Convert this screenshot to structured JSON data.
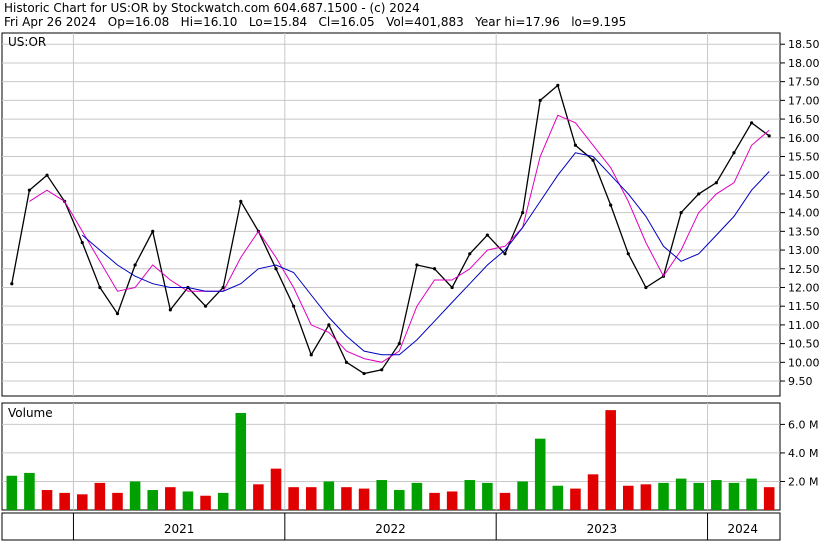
{
  "header": {
    "title_line": "Historic Chart for US:OR by Stockwatch.com 604.687.1500 - (c) 2024",
    "stats_line": "Fri Apr 26 2024   Op=16.08   Hi=16.10   Lo=15.84   Cl=16.05   Vol=401,883   Year hi=17.96   lo=9.195"
  },
  "chart_data": [
    {
      "type": "line",
      "panel": "price",
      "label": "US:OR",
      "ylim": [
        9.1,
        18.8
      ],
      "yticks": [
        9.5,
        10.0,
        10.5,
        11.0,
        11.5,
        12.0,
        12.5,
        13.0,
        13.5,
        14.0,
        14.5,
        15.0,
        15.5,
        16.0,
        16.5,
        17.0,
        17.5,
        18.0,
        18.5
      ],
      "ytick_labels": [
        "9.50",
        "10.00",
        "10.50",
        "11.00",
        "11.50",
        "12.00",
        "12.50",
        "13.00",
        "13.50",
        "14.00",
        "14.50",
        "15.00",
        "15.50",
        "16.00",
        "16.50",
        "17.00",
        "17.50",
        "18.00",
        "18.50"
      ],
      "x_labels": [
        "2021",
        "2022",
        "2023",
        "2024"
      ],
      "grid": true,
      "series": [
        {
          "style": "daily high-low bars",
          "color": "#000000",
          "x": [
            "2020-09",
            "2020-10",
            "2020-11",
            "2020-12",
            "2021-01",
            "2021-02",
            "2021-03",
            "2021-04",
            "2021-05",
            "2021-06",
            "2021-07",
            "2021-08",
            "2021-09",
            "2021-10",
            "2021-11",
            "2021-12",
            "2022-01",
            "2022-02",
            "2022-03",
            "2022-04",
            "2022-05",
            "2022-06",
            "2022-07",
            "2022-08",
            "2022-09",
            "2022-10",
            "2022-11",
            "2022-12",
            "2023-01",
            "2023-02",
            "2023-03",
            "2023-04",
            "2023-05",
            "2023-06",
            "2023-07",
            "2023-08",
            "2023-09",
            "2023-10",
            "2023-11",
            "2023-12",
            "2024-01",
            "2024-02",
            "2024-03",
            "2024-04"
          ],
          "values": [
            12.1,
            14.6,
            15.0,
            14.3,
            13.2,
            12.0,
            11.3,
            12.6,
            13.5,
            11.4,
            12.0,
            11.5,
            12.0,
            14.3,
            13.5,
            12.5,
            11.5,
            10.2,
            11.0,
            10.0,
            9.7,
            9.8,
            10.5,
            12.6,
            12.5,
            12.0,
            12.9,
            13.4,
            12.9,
            14.0,
            17.0,
            17.4,
            15.8,
            15.4,
            14.2,
            12.9,
            12.0,
            12.3,
            14.0,
            14.5,
            14.8,
            15.6,
            16.4,
            16.05
          ]
        },
        {
          "style": "short moving average",
          "color": "#e000c0",
          "x": [
            "2020-09",
            "2020-10",
            "2020-11",
            "2020-12",
            "2021-01",
            "2021-02",
            "2021-03",
            "2021-04",
            "2021-05",
            "2021-06",
            "2021-07",
            "2021-08",
            "2021-09",
            "2021-10",
            "2021-11",
            "2021-12",
            "2022-01",
            "2022-02",
            "2022-03",
            "2022-04",
            "2022-05",
            "2022-06",
            "2022-07",
            "2022-08",
            "2022-09",
            "2022-10",
            "2022-11",
            "2022-12",
            "2023-01",
            "2023-02",
            "2023-03",
            "2023-04",
            "2023-05",
            "2023-06",
            "2023-07",
            "2023-08",
            "2023-09",
            "2023-10",
            "2023-11",
            "2023-12",
            "2024-01",
            "2024-02",
            "2024-03",
            "2024-04"
          ],
          "values": [
            null,
            14.3,
            14.6,
            14.3,
            13.5,
            12.7,
            11.9,
            12.0,
            12.6,
            12.2,
            11.9,
            11.9,
            11.9,
            12.8,
            13.5,
            12.8,
            12.0,
            11.0,
            10.8,
            10.3,
            10.1,
            10.0,
            10.3,
            11.5,
            12.2,
            12.2,
            12.5,
            13.0,
            13.1,
            13.6,
            15.5,
            16.6,
            16.4,
            15.8,
            15.2,
            14.3,
            13.2,
            12.3,
            13.0,
            14.0,
            14.5,
            14.8,
            15.8,
            16.2
          ]
        },
        {
          "style": "long moving average",
          "color": "#0000c0",
          "x": [
            "2020-09",
            "2020-10",
            "2020-11",
            "2020-12",
            "2021-01",
            "2021-02",
            "2021-03",
            "2021-04",
            "2021-05",
            "2021-06",
            "2021-07",
            "2021-08",
            "2021-09",
            "2021-10",
            "2021-11",
            "2021-12",
            "2022-01",
            "2022-02",
            "2022-03",
            "2022-04",
            "2022-05",
            "2022-06",
            "2022-07",
            "2022-08",
            "2022-09",
            "2022-10",
            "2022-11",
            "2022-12",
            "2023-01",
            "2023-02",
            "2023-03",
            "2023-04",
            "2023-05",
            "2023-06",
            "2023-07",
            "2023-08",
            "2023-09",
            "2023-10",
            "2023-11",
            "2023-12",
            "2024-01",
            "2024-02",
            "2024-03",
            "2024-04"
          ],
          "values": [
            null,
            null,
            null,
            null,
            13.4,
            13.0,
            12.6,
            12.3,
            12.1,
            12.0,
            12.0,
            11.9,
            11.9,
            12.1,
            12.5,
            12.6,
            12.4,
            11.8,
            11.2,
            10.7,
            10.3,
            10.2,
            10.2,
            10.6,
            11.1,
            11.6,
            12.1,
            12.6,
            13.0,
            13.6,
            14.3,
            15.0,
            15.6,
            15.5,
            15.0,
            14.5,
            13.9,
            13.1,
            12.7,
            12.9,
            13.4,
            13.9,
            14.6,
            15.1
          ]
        }
      ]
    },
    {
      "type": "bar",
      "panel": "volume",
      "label": "Volume",
      "ylim": [
        0,
        7.5
      ],
      "yticks": [
        2,
        4,
        6
      ],
      "ytick_labels": [
        "2.0 M",
        "4.0 M",
        "6.0 M"
      ],
      "grid": true,
      "colors": {
        "up": "#00a000",
        "down": "#e00000"
      },
      "x": [
        "2020-09",
        "2020-10",
        "2020-11",
        "2020-12",
        "2021-01",
        "2021-02",
        "2021-03",
        "2021-04",
        "2021-05",
        "2021-06",
        "2021-07",
        "2021-08",
        "2021-09",
        "2021-10",
        "2021-11",
        "2021-12",
        "2022-01",
        "2022-02",
        "2022-03",
        "2022-04",
        "2022-05",
        "2022-06",
        "2022-07",
        "2022-08",
        "2022-09",
        "2022-10",
        "2022-11",
        "2022-12",
        "2023-01",
        "2023-02",
        "2023-03",
        "2023-04",
        "2023-05",
        "2023-06",
        "2023-07",
        "2023-08",
        "2023-09",
        "2023-10",
        "2023-11",
        "2023-12",
        "2024-01",
        "2024-02",
        "2024-03",
        "2024-04"
      ],
      "values": [
        2.4,
        2.6,
        1.4,
        1.2,
        1.1,
        1.9,
        1.2,
        2.0,
        1.4,
        1.6,
        1.3,
        1.0,
        1.2,
        6.8,
        1.8,
        2.9,
        1.6,
        1.6,
        2.0,
        1.6,
        1.5,
        2.1,
        1.4,
        1.9,
        1.2,
        1.3,
        2.1,
        1.9,
        1.2,
        2.0,
        5.0,
        1.7,
        1.5,
        2.5,
        7.0,
        1.7,
        1.8,
        1.9,
        2.2,
        1.9,
        2.1,
        1.9,
        2.2,
        1.6
      ],
      "direction": [
        "up",
        "up",
        "down",
        "down",
        "down",
        "down",
        "down",
        "up",
        "up",
        "down",
        "up",
        "down",
        "up",
        "up",
        "down",
        "down",
        "down",
        "down",
        "up",
        "down",
        "down",
        "up",
        "up",
        "up",
        "down",
        "down",
        "up",
        "up",
        "down",
        "up",
        "up",
        "up",
        "down",
        "down",
        "down",
        "down",
        "down",
        "up",
        "up",
        "up",
        "up",
        "up",
        "up",
        "down"
      ]
    }
  ]
}
